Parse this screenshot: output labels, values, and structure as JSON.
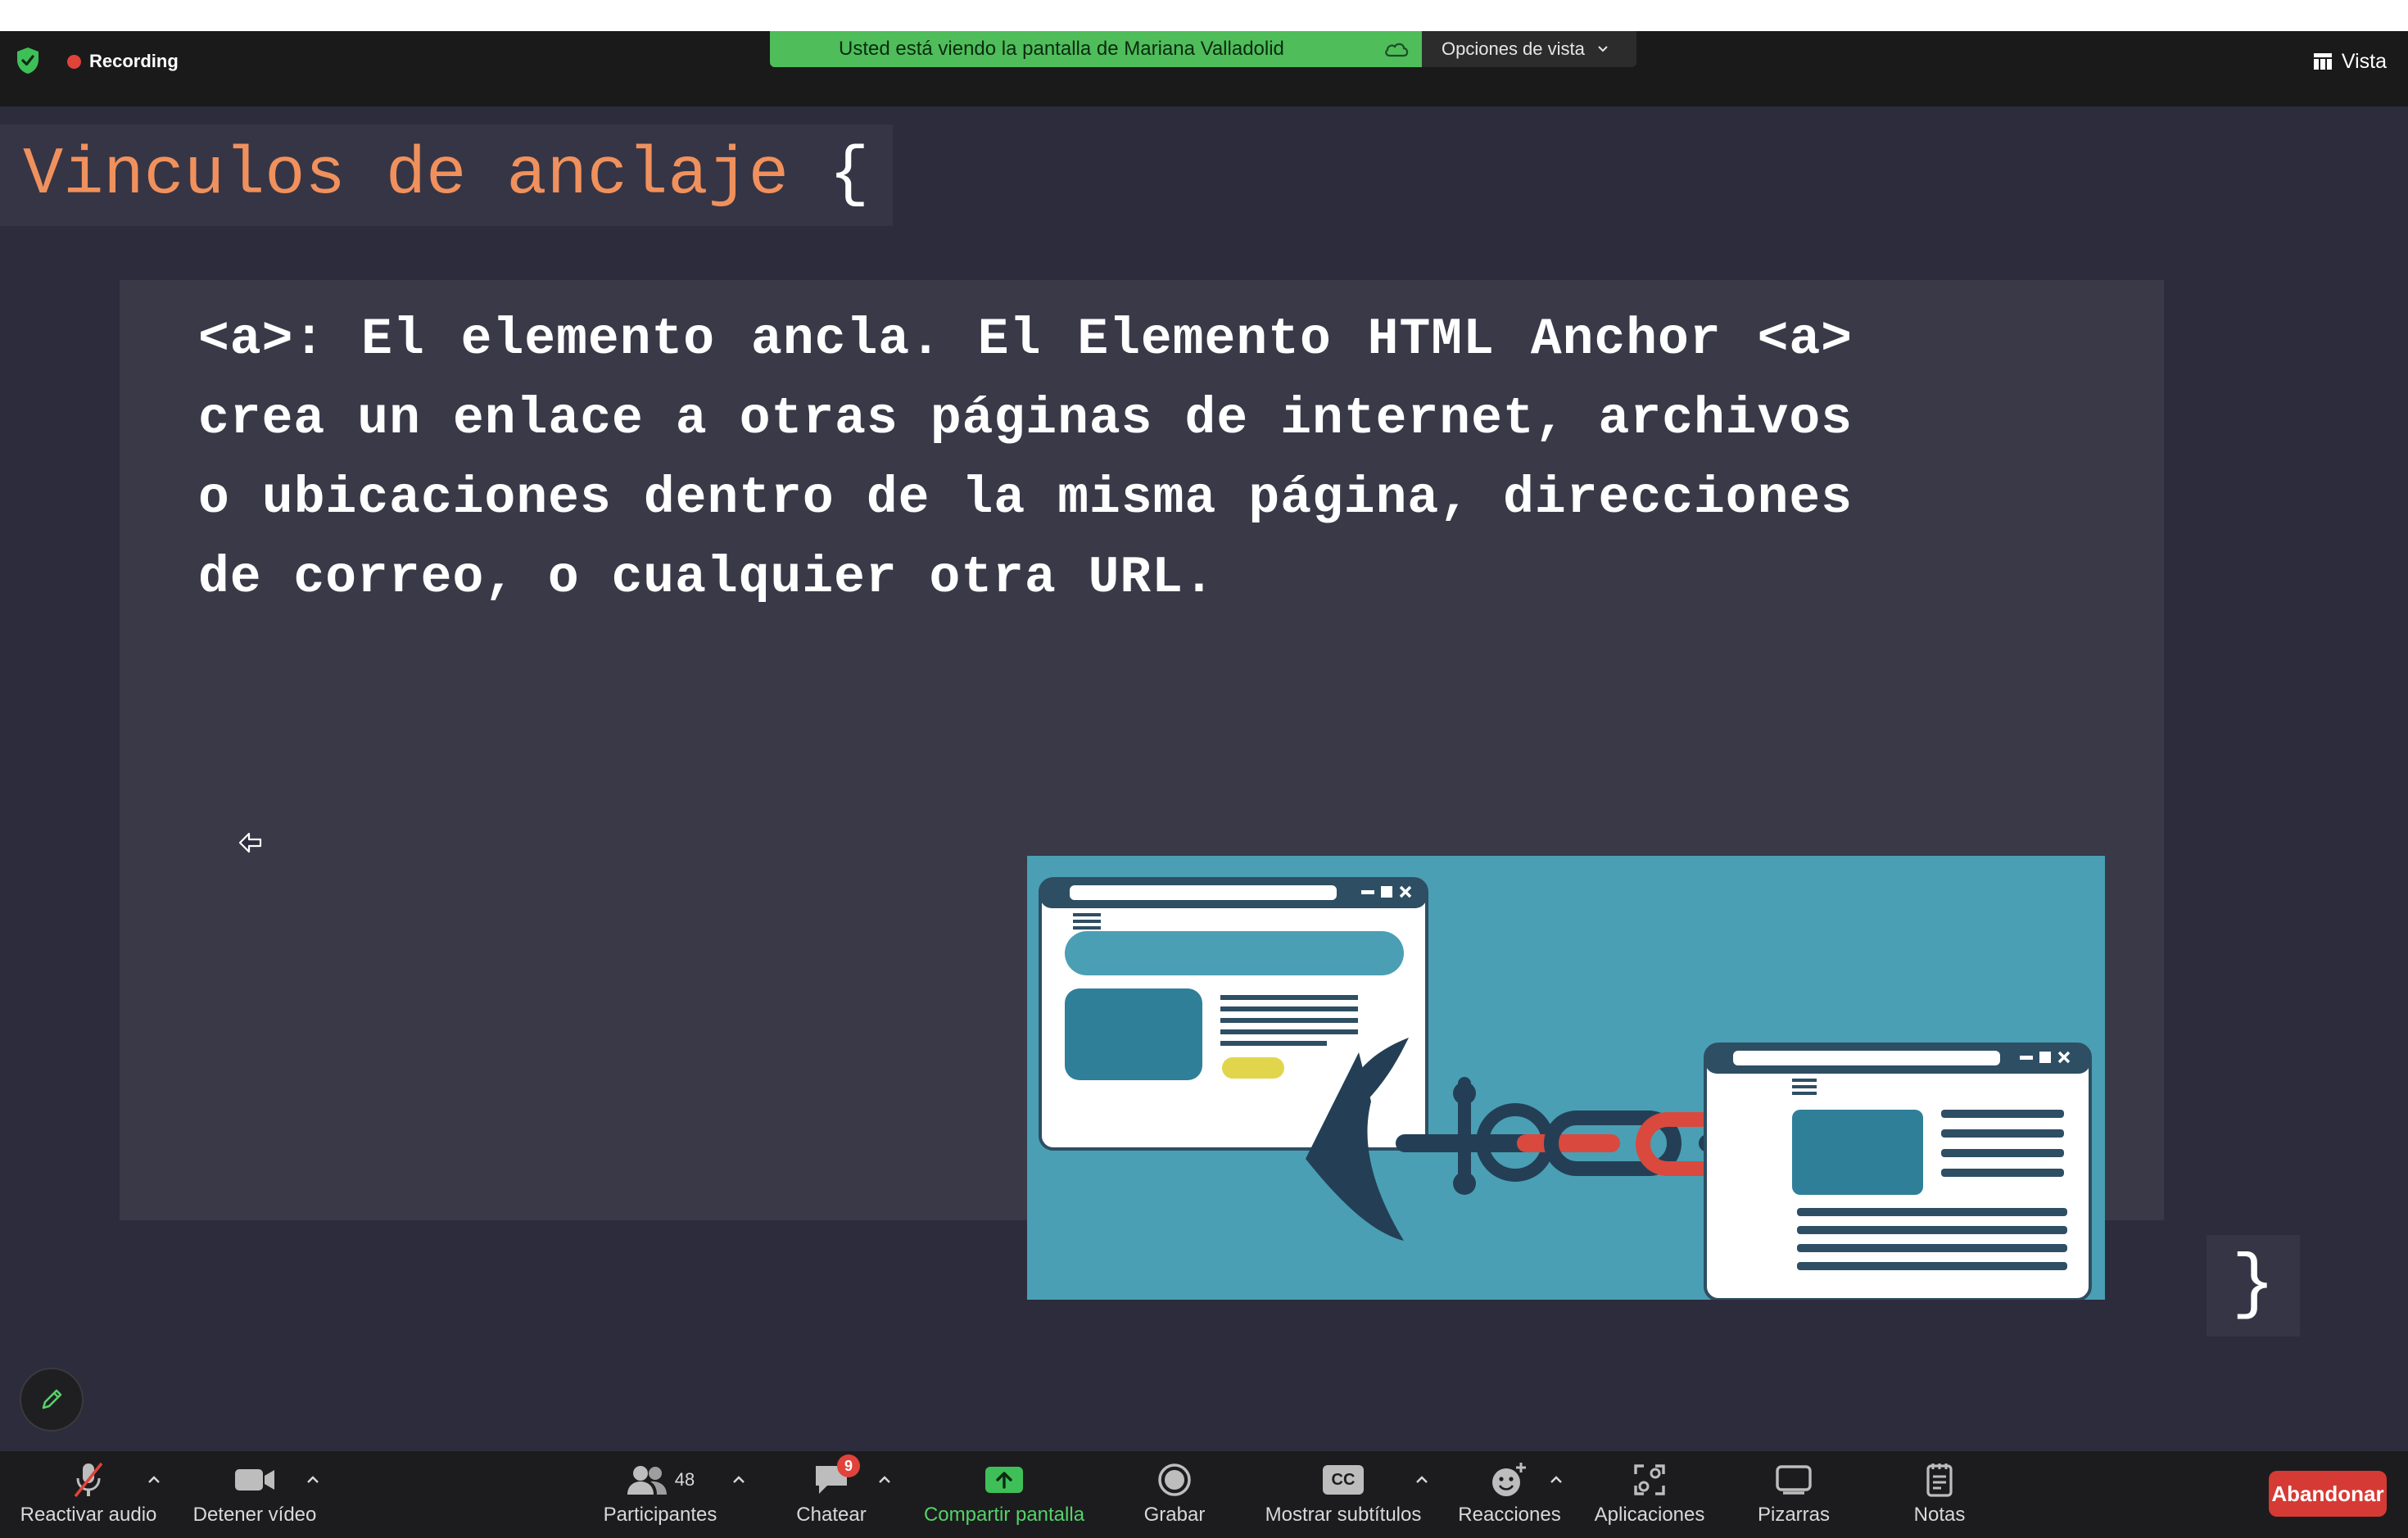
{
  "top_bar": {
    "recording_label": "Recording",
    "share_banner_text": "Usted está viendo la pantalla de Mariana Valladolid",
    "view_options_label": "Opciones de vista",
    "vista_label": "Vista"
  },
  "slide": {
    "title": "Vinculos de anclaje",
    "open_brace": "{",
    "body": "<a>: El elemento ancla. El Elemento HTML Anchor <a> crea un enlace a otras páginas de internet, archivos o ubicaciones dentro de la misma página, direcciones de correo, o cualquier otra URL.",
    "close_brace": "}"
  },
  "toolbar": {
    "mute_label": "Reactivar audio",
    "video_label": "Detener vídeo",
    "participants_label": "Participantes",
    "participants_count": "48",
    "chat_label": "Chatear",
    "chat_badge": "9",
    "share_label": "Compartir pantalla",
    "record_label": "Grabar",
    "captions_label": "Mostrar subtítulos",
    "captions_icon_text": "CC",
    "reactions_label": "Reacciones",
    "apps_label": "Aplicaciones",
    "whiteboards_label": "Pizarras",
    "notes_label": "Notas",
    "leave_label": "Abandonar"
  },
  "colors": {
    "stage_bg": "#2d2c3d",
    "title_color": "#f0915d",
    "share_banner": "#4fbd5a",
    "leave_button": "#d63a34",
    "illustration_bg": "#4a9fb4"
  }
}
